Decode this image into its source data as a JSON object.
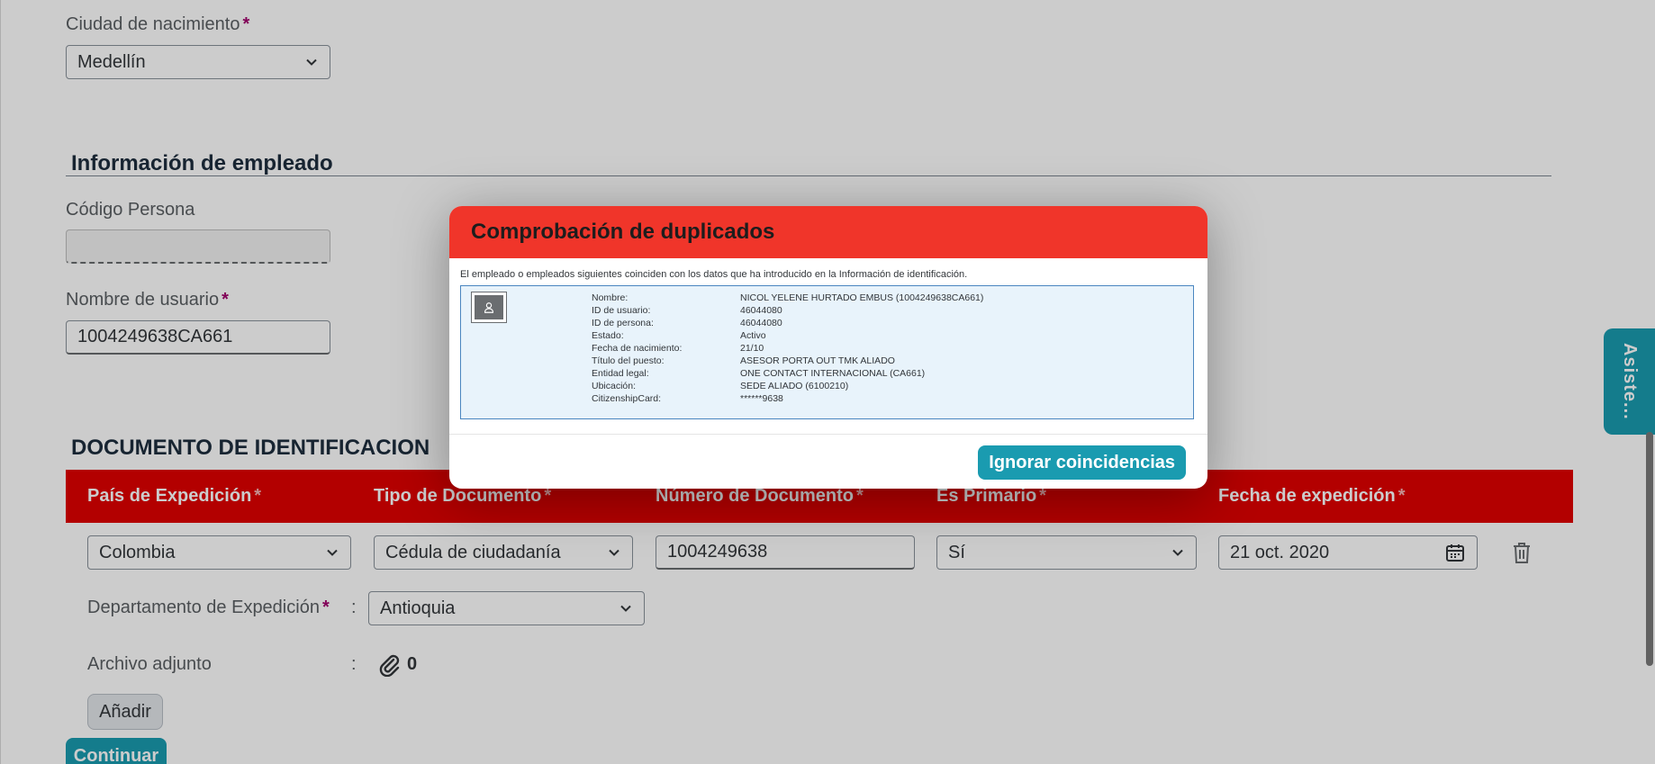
{
  "birth_city": {
    "label": "Ciudad de nacimiento",
    "required_mark": "*",
    "value": "Medellín"
  },
  "employee_info": {
    "title": "Información de empleado",
    "codigo_persona_label": "Código Persona",
    "codigo_persona_value": "",
    "username_label": "Nombre de usuario",
    "username_required_mark": "*",
    "username_value": "1004249638CA661"
  },
  "id_document": {
    "title": "DOCUMENTO DE IDENTIFICACION",
    "columns": [
      {
        "label": "País de Expedición",
        "req": "*"
      },
      {
        "label": "Tipo de Documento",
        "req": "*"
      },
      {
        "label": "Número de Documento",
        "req": "*"
      },
      {
        "label": "Es Primario",
        "req": "*"
      },
      {
        "label": "Fecha de expedición",
        "req": "*"
      }
    ],
    "row": {
      "pais": "Colombia",
      "tipo": "Cédula de ciudadanía",
      "numero": "1004249638",
      "primario": "Sí",
      "fecha": "21 oct. 2020"
    },
    "departamento_label": "Departamento de Expedición",
    "departamento_req": "*",
    "colon": ":",
    "departamento_value": "Antioquia",
    "attachment_label": "Archivo adjunto",
    "attachment_count": "0",
    "add_button": "Añadir"
  },
  "continue_button": "Continuar",
  "side_tab": "Asiste...",
  "dialog": {
    "title": "Comprobación de duplicados",
    "intro": "El empleado o empleados siguientes coinciden con los datos que ha introducido en la Información de identificación.",
    "match": [
      {
        "k": "Nombre:",
        "v": "NICOL YELENE HURTADO EMBUS (1004249638CA661)"
      },
      {
        "k": "ID de usuario:",
        "v": "46044080"
      },
      {
        "k": "ID de persona:",
        "v": "46044080"
      },
      {
        "k": "Estado:",
        "v": "Activo"
      },
      {
        "k": "Fecha de nacimiento:",
        "v": "21/10"
      },
      {
        "k": "Título del puesto:",
        "v": "ASESOR PORTA OUT TMK ALIADO"
      },
      {
        "k": "Entidad legal:",
        "v": "ONE CONTACT INTERNACIONAL (CA661)"
      },
      {
        "k": "Ubicación:",
        "v": "SEDE ALIADO (6100210)"
      },
      {
        "k": "CitizenshipCard:",
        "v": "******9638"
      }
    ],
    "ignore_button": "Ignorar coincidencias"
  },
  "colors": {
    "accent_teal": "#1a9bb0",
    "header_red": "#e00000",
    "dialog_red": "#f0352a",
    "required": "#a2006d"
  },
  "icons": [
    "chevron-down-icon",
    "calendar-icon",
    "trash-icon",
    "paperclip-icon",
    "person-placeholder-icon"
  ]
}
